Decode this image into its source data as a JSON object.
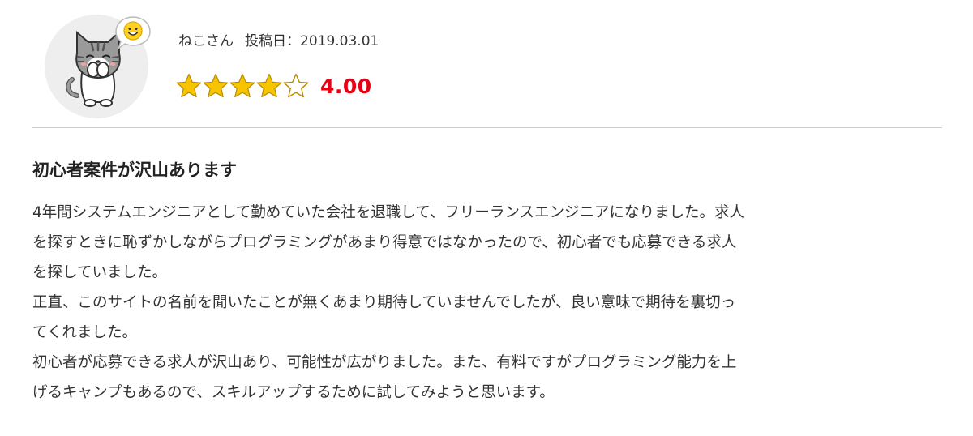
{
  "reviewer": {
    "name": "ねこさん",
    "date_label": "投稿日：",
    "date": "2019.03.01",
    "avatar_icon": "cat-avatar-icon",
    "bubble_icon": "smiley-bubble-icon"
  },
  "rating": {
    "score": "4.00",
    "value": 4,
    "max": 5,
    "star_color": "#f6c400",
    "score_color": "#e60012"
  },
  "review": {
    "title": "初心者案件が沢山あります",
    "lines": [
      "4年間システムエンジニアとして勤めていた会社を退職して、フリーランスエンジニアになりました。求人",
      "を探すときに恥ずかしながらプログラミングがあまり得意ではなかったので、初心者でも応募できる求人",
      "を探していました。",
      "正直、このサイトの名前を聞いたことが無くあまり期待していませんでしたが、良い意味で期待を裏切っ",
      "てくれました。",
      "初心者が応募できる求人が沢山あり、可能性が広がりました。また、有料ですがプログラミング能力を上",
      "げるキャンプもあるので、スキルアップするために試してみようと思います。"
    ]
  }
}
